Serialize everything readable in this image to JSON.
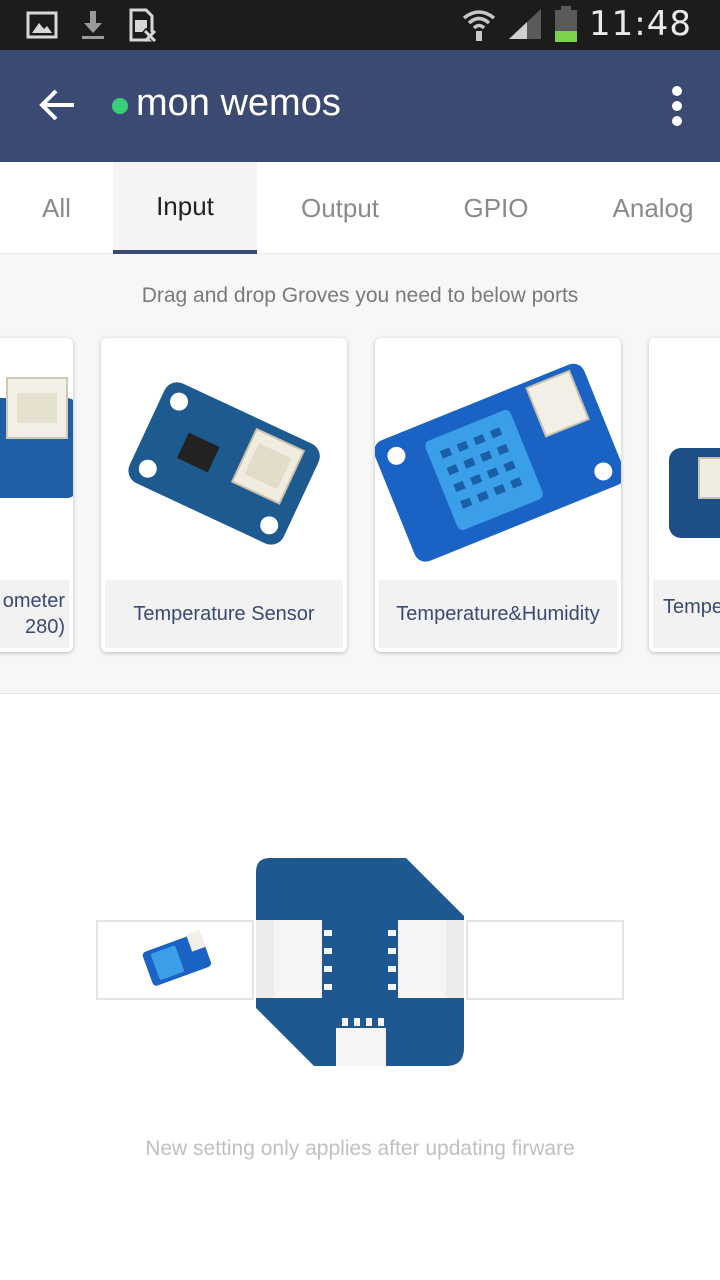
{
  "status_bar": {
    "time": "11:48",
    "icons": [
      "gallery-icon",
      "download-icon",
      "sim-blocked-icon",
      "wifi-icon",
      "signal-icon",
      "battery-icon"
    ]
  },
  "app_bar": {
    "title": "mon wemos",
    "status_color": "#3ad07a",
    "background": "#3a4a72"
  },
  "tabs": [
    {
      "label": "All",
      "active": false
    },
    {
      "label": "Input",
      "active": true
    },
    {
      "label": "Output",
      "active": false
    },
    {
      "label": "GPIO",
      "active": false
    },
    {
      "label": "Analog",
      "active": false
    }
  ],
  "groves": {
    "hint": "Drag and drop Groves you need to below ports",
    "cards": [
      {
        "label_line1": "ometer",
        "label_line2": "280)"
      },
      {
        "label": "Temperature Sensor"
      },
      {
        "label": "Temperature&Humidity"
      },
      {
        "label": "Tempe"
      }
    ]
  },
  "board": {
    "left_port": "Temperature&Humidity",
    "footer_note": "New setting only applies after updating firware"
  }
}
